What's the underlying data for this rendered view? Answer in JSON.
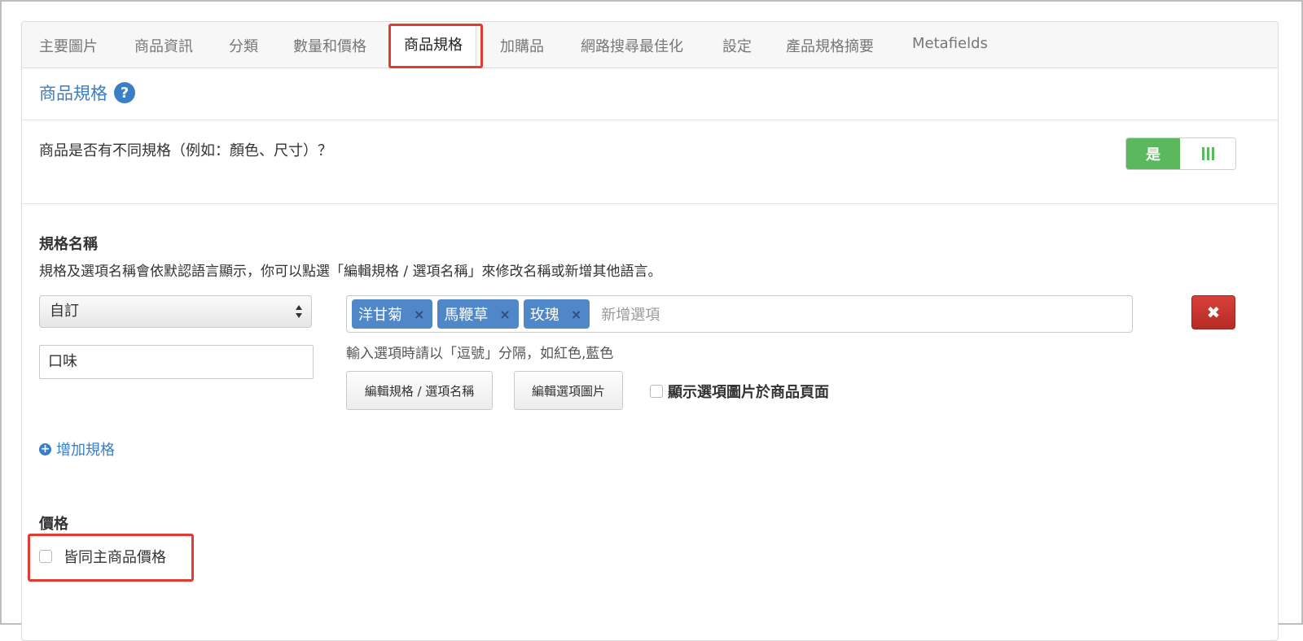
{
  "tabs": [
    {
      "label": "主要圖片"
    },
    {
      "label": "商品資訊"
    },
    {
      "label": "分類"
    },
    {
      "label": "數量和價格"
    },
    {
      "label": "商品規格",
      "active": true
    },
    {
      "label": "加購品"
    },
    {
      "label": "網路搜尋最佳化"
    },
    {
      "label": "設定"
    },
    {
      "label": "產品規格摘要"
    },
    {
      "label": "Metafields"
    }
  ],
  "section": {
    "title": "商品規格",
    "help_icon": "question-circle-icon"
  },
  "variation_question": {
    "text": "商品是否有不同規格（例如：顏色、尺寸）？",
    "toggle_on_label": "是",
    "toggle_state": "on"
  },
  "spec_name": {
    "label": "規格名稱",
    "description": "規格及選項名稱會依默認語言顯示，你可以點選「編輯規格 / 選項名稱」來修改名稱或新增其他語言。",
    "select_value": "自訂",
    "custom_name_value": "口味",
    "options": [
      "洋甘菊",
      "馬鞭草",
      "玫瑰"
    ],
    "tag_remove_symbol": "×",
    "new_option_placeholder": "新增選項",
    "hint": "輸入選項時請以「逗號」分隔，如紅色,藍色",
    "edit_names_button": "編輯規格 / 選項名稱",
    "edit_images_button": "編輯選項圖片",
    "show_images_label": "顯示選項圖片於商品頁面",
    "delete_symbol": "✖"
  },
  "add_spec": {
    "label": "增加規格",
    "icon": "plus-circle-icon"
  },
  "price": {
    "label": "價格",
    "same_as_main_label": "皆同主商品價格"
  },
  "colors": {
    "accent": "#3a7fc4",
    "toggle_on": "#5cb85c",
    "danger": "#c9302c",
    "highlight": "#e23b32",
    "tag": "#4f87c9"
  }
}
